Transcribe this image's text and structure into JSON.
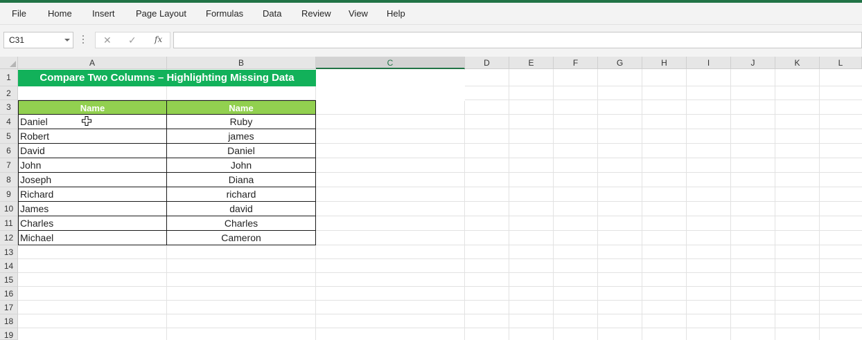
{
  "ribbon": {
    "tabs": [
      "File",
      "Home",
      "Insert",
      "Page Layout",
      "Formulas",
      "Data",
      "Review",
      "View",
      "Help"
    ]
  },
  "formula_bar": {
    "name_box": "C31",
    "cancel_icon": "✕",
    "enter_icon": "✓",
    "fx_label": "fx",
    "formula_value": ""
  },
  "grid": {
    "columns": [
      "A",
      "B",
      "C",
      "D",
      "E",
      "F",
      "G",
      "H",
      "I",
      "J",
      "K",
      "L"
    ],
    "selected_column": "C",
    "rows": [
      "1",
      "2",
      "3",
      "4",
      "5",
      "6",
      "7",
      "8",
      "9",
      "10",
      "11",
      "12",
      "13",
      "14",
      "15",
      "16",
      "17",
      "18",
      "19"
    ]
  },
  "sheet": {
    "title": "Compare Two Columns – Highlighting Missing Data",
    "headers": [
      "Name",
      "Name"
    ],
    "col_a": [
      "Daniel",
      "Robert",
      "David",
      "John",
      "Joseph",
      "Richard",
      "James",
      "Charles",
      "Michael"
    ],
    "col_b": [
      "Ruby",
      "james",
      "Daniel",
      "John",
      "Diana",
      "richard",
      "david",
      "Charles",
      "Cameron"
    ]
  },
  "colors": {
    "excel_green": "#217346",
    "title_fill": "#12b15a",
    "header_fill": "#92d050"
  }
}
